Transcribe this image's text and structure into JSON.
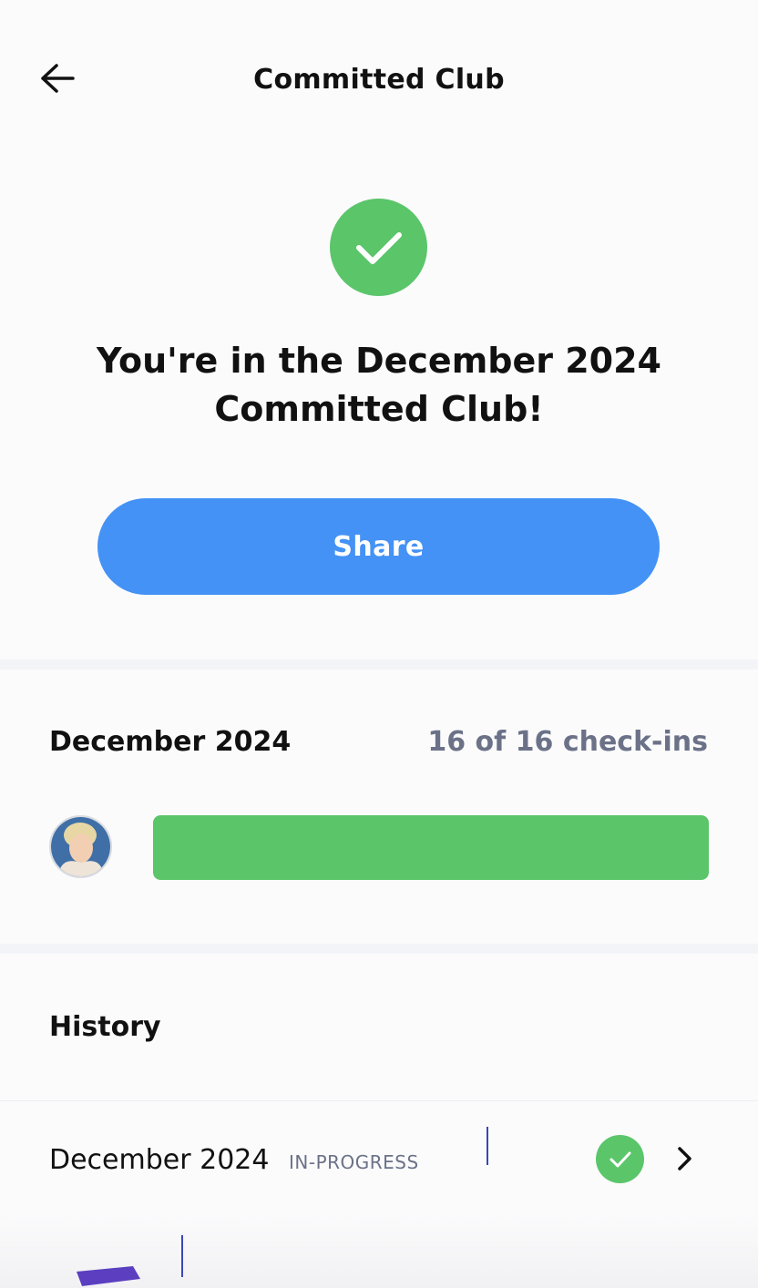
{
  "header": {
    "title": "Committed Club",
    "back_icon": "arrow-left-icon"
  },
  "hero": {
    "icon": "check-circle-icon",
    "message": "You're in the December 2024 Committed Club!",
    "share_label": "Share"
  },
  "current": {
    "month": "December 2024",
    "checkins_text": "16 of 16 check-ins",
    "progress_fraction": 1.0,
    "avatar_icon": "user-avatar"
  },
  "history": {
    "title": "History",
    "items": [
      {
        "month": "December 2024",
        "badge": "IN-PROGRESS",
        "status_icon": "check-circle-icon",
        "chevron_icon": "chevron-right-icon"
      }
    ]
  },
  "colors": {
    "accent_blue": "#4492f5",
    "success_green": "#5bc56a",
    "muted_text": "#6b7288"
  }
}
